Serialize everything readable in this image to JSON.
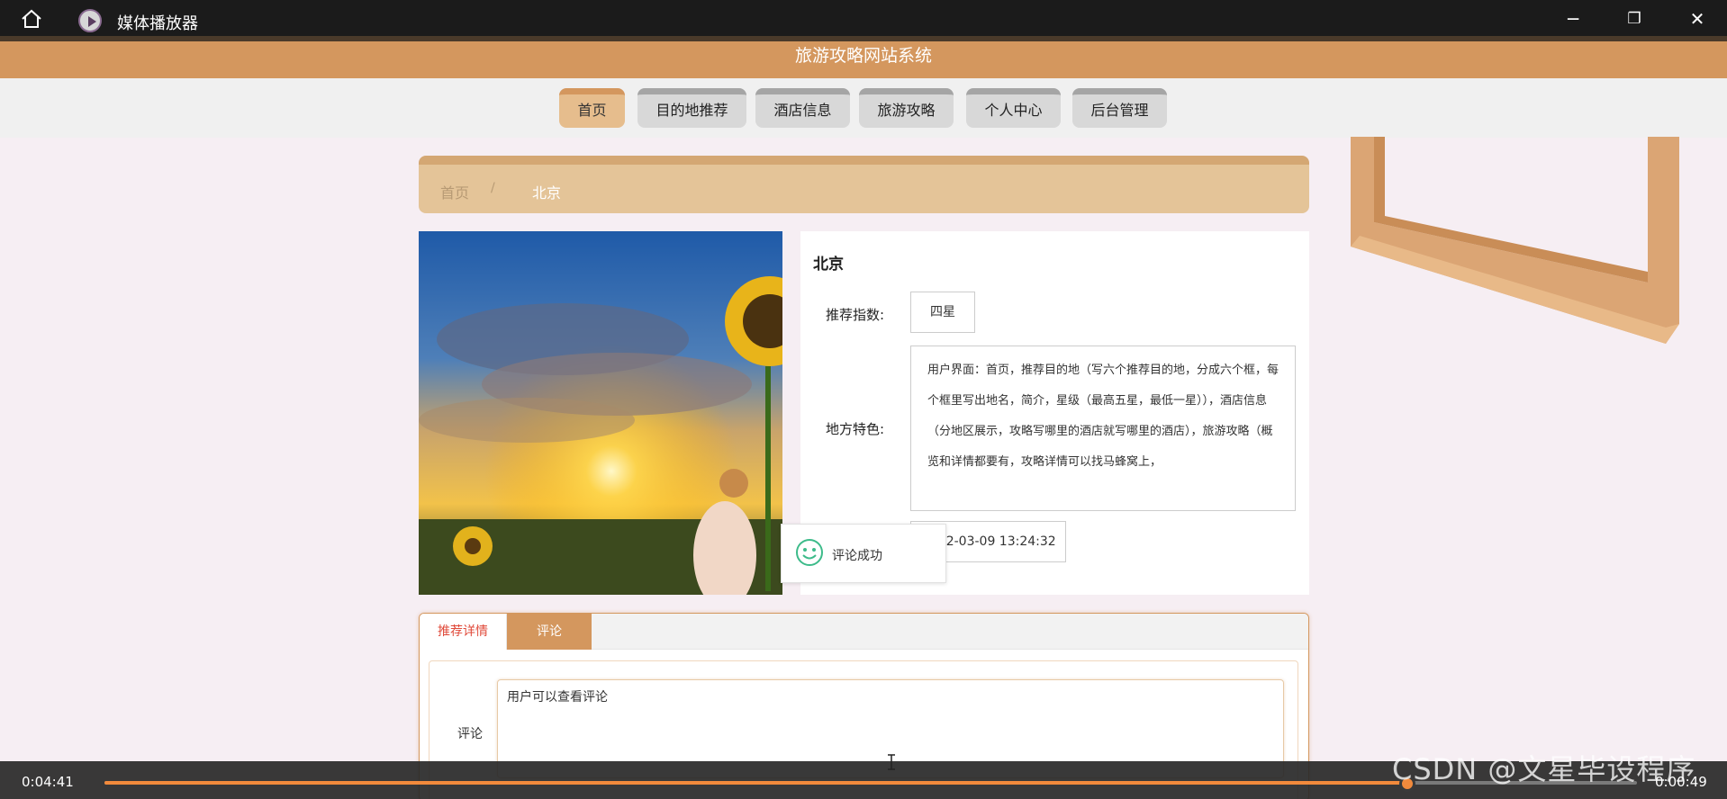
{
  "window": {
    "title": "媒体播放器",
    "home_icon": "home-icon",
    "app_icon": "media-player-icon",
    "controls": [
      "minimize-icon",
      "restore-icon",
      "close-icon"
    ],
    "minimize_glyph": "─",
    "restore_glyph": "❐",
    "close_glyph": "✕"
  },
  "site": {
    "title": "旅游攻略网站系统",
    "accent_color": "#d4975e"
  },
  "nav": {
    "items": [
      {
        "label": "首页",
        "active": true
      },
      {
        "label": "目的地推荐",
        "active": false
      },
      {
        "label": "酒店信息",
        "active": false
      },
      {
        "label": "旅游攻略",
        "active": false
      },
      {
        "label": "个人中心",
        "active": false
      },
      {
        "label": "后台管理",
        "active": false
      }
    ]
  },
  "breadcrumb": {
    "home": "首页",
    "separator": "/",
    "current": "北京"
  },
  "detail": {
    "name": "北京",
    "rating_label": "推荐指数:",
    "rating_value": "四星",
    "feature_label": "地方特色:",
    "feature_text": "用户界面：首页，推荐目的地（写六个推荐目的地，分成六个框，每个框里写出地名，简介，星级（最高五星，最低一星）），酒店信息（分地区展示，攻略写哪里的酒店就写哪里的酒店），旅游攻略（概览和详情都要有，攻略详情可以找马蜂窝上，",
    "time_value": "2022-03-09 13:24:32"
  },
  "toast": {
    "icon": "smiley-icon",
    "text": "评论成功"
  },
  "tabs": {
    "items": [
      "推荐详情",
      "评论"
    ],
    "comment_label": "评论",
    "comment_value": "用户可以查看评论"
  },
  "player": {
    "elapsed": "0:04:41",
    "remaining": "0:00:49",
    "progress": 0.85
  },
  "watermark": "CSDN @文星毕设程序"
}
